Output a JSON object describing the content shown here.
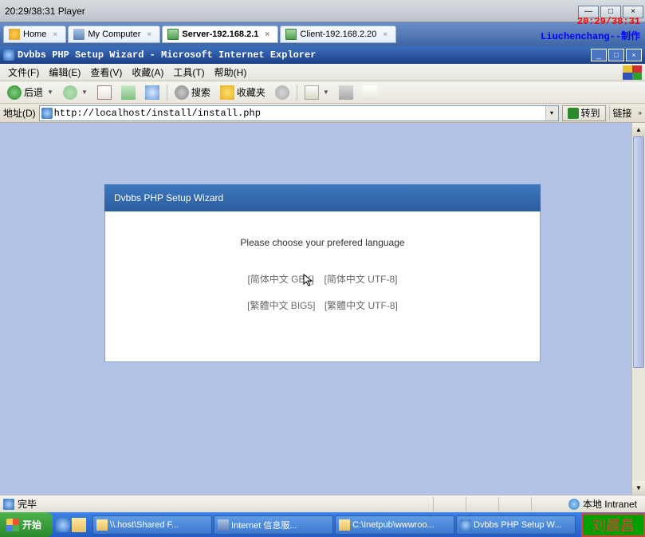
{
  "vm_title": "20:29/38:31 Player",
  "vm_overlay_time": "20:29/38:31",
  "vm_overlay_text": "Liuchenchang--制作",
  "vm_tabs": [
    {
      "label": "Home"
    },
    {
      "label": "My Computer"
    },
    {
      "label": "Server-192.168.2.1",
      "active": true
    },
    {
      "label": "Client-192.168.2.20"
    }
  ],
  "ie_title": "Dvbbs PHP Setup Wizard - Microsoft Internet Explorer",
  "menu": {
    "file": "文件(F)",
    "edit": "编辑(E)",
    "view": "查看(V)",
    "favorites": "收藏(A)",
    "tools": "工具(T)",
    "help": "帮助(H)"
  },
  "toolbar": {
    "back": "后退",
    "search": "搜索",
    "favorites": "收藏夹"
  },
  "addr": {
    "label": "地址(D)",
    "value": "http://localhost/install/install.php",
    "go": "转到",
    "links": "链接"
  },
  "wizard": {
    "title": "Dvbbs PHP Setup Wizard",
    "prompt": "Please choose your prefered language",
    "langs": {
      "gbk": "[简体中文 GBK]",
      "utf8s": "[简体中文 UTF-8]",
      "big5": "[繁體中文 BIG5]",
      "utf8t": "[繁體中文 UTF-8]"
    }
  },
  "status": {
    "done": "完毕",
    "zone": "本地 Intranet"
  },
  "taskbar": {
    "start": "开始",
    "tasks": [
      "\\\\.host\\Shared F...",
      "Internet 信息服...",
      "C:\\Inetpub\\wwwroo...",
      "Dvbbs PHP Setup W..."
    ]
  },
  "name_box": "刘晨昌"
}
